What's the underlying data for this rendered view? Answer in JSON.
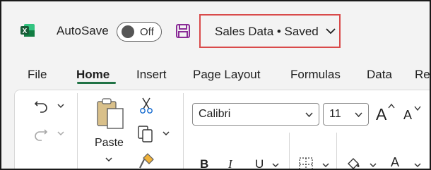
{
  "titlebar": {
    "autosave_label": "AutoSave",
    "autosave_state": "Off",
    "document_title": "Sales Data • Saved"
  },
  "tabs": [
    {
      "label": "File",
      "active": false
    },
    {
      "label": "Home",
      "active": true
    },
    {
      "label": "Insert",
      "active": false
    },
    {
      "label": "Page Layout",
      "active": false
    },
    {
      "label": "Formulas",
      "active": false
    },
    {
      "label": "Data",
      "active": false
    },
    {
      "label": "Re",
      "active": false
    }
  ],
  "clipboard": {
    "paste_label": "Paste"
  },
  "font": {
    "family": "Calibri",
    "size": "11",
    "bold": "B",
    "italic": "I",
    "underline": "U",
    "grow": "A",
    "shrink": "A",
    "font_color_letter": "A"
  },
  "colors": {
    "excel_green": "#217346",
    "highlight_yellow": "#ffff00",
    "font_red": "#e0202a",
    "callout_red": "#d94a4a"
  }
}
